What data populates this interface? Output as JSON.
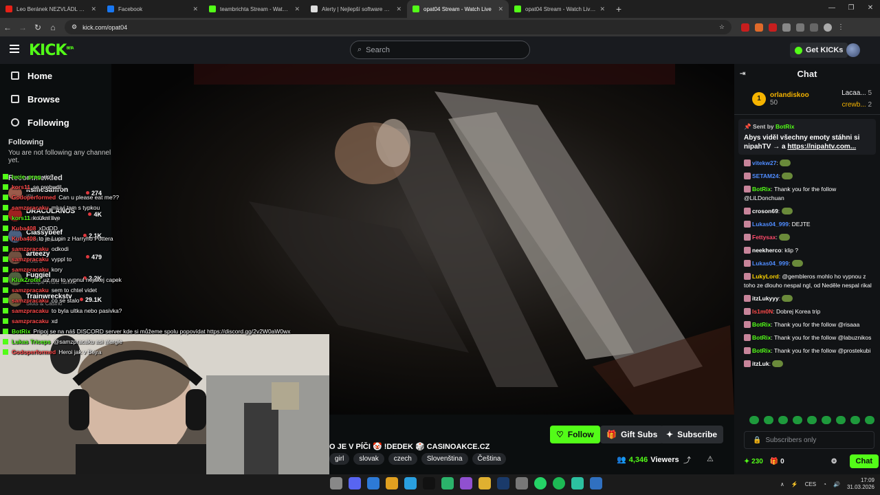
{
  "tabs": [
    {
      "title": "Leo Beránek NEZVLÁDL Svobo",
      "color": "#e62117",
      "active": false
    },
    {
      "title": "Facebook",
      "color": "#1877f2",
      "active": false
    },
    {
      "title": "teambrichta Stream - Watch Liv",
      "color": "#53fc18",
      "active": false
    },
    {
      "title": "Alerty | Nejlepší software pro v",
      "color": "#dddddd",
      "active": false
    },
    {
      "title": "opat04 Stream - Watch Live",
      "color": "#53fc18",
      "active": true
    },
    {
      "title": "opat04 Stream - Watch Live on",
      "color": "#53fc18",
      "active": false
    }
  ],
  "browser": {
    "url": "kick.com/opat04"
  },
  "nav": {
    "logo": "KICK",
    "logo_sup": "BETA",
    "search_placeholder": "Search",
    "get_kicks": "Get KICKs"
  },
  "sidebar": {
    "items": [
      {
        "label": "Home"
      },
      {
        "label": "Browse"
      },
      {
        "label": "Following"
      }
    ],
    "following_title": "Following",
    "following_empty": "You are not following any channel yet.",
    "recommended_title": "Recommended",
    "recommended": [
      {
        "name": "itsmeSaffron",
        "category": "IRL",
        "viewers": "274",
        "color": "#9b5b4b"
      },
      {
        "name": "DRACULANOS",
        "category": "Just Chatting",
        "viewers": "4K",
        "color": "#a02020"
      },
      {
        "name": "Classybeef",
        "category": "Slots & Casino",
        "viewers": "2.1K",
        "color": "#4a6080"
      },
      {
        "name": "arteezy",
        "category": "Dota 2",
        "viewers": "479",
        "color": "#705040"
      },
      {
        "name": "Fuggiel",
        "category": "Escape From Tarkov",
        "viewers": "2.2K",
        "color": "#506040"
      },
      {
        "name": "Trainwreckstv",
        "category": "Slots & Casino",
        "viewers": "29.1K",
        "color": "#6a5a3a"
      }
    ]
  },
  "overlay_chat": [
    {
      "user": "lucie_prag",
      "text": "rip?",
      "color": "#53fc18"
    },
    {
      "user": "kors11",
      "text": "se probudil",
      "color": "#ff4a4a"
    },
    {
      "user": "Godoperformed",
      "text": "Can u please eat me??",
      "color": "#ff4a4a"
    },
    {
      "user": "samzpracaku",
      "text": "mluvi tam s typkou",
      "color": "#ff4a4a"
    },
    {
      "user": "kors11",
      "text": "koukni live",
      "color": "#53fc18"
    },
    {
      "user": "Kuba408",
      "text": "xDdDD",
      "color": "#ff4a4a"
    },
    {
      "user": "Kuba408",
      "text": "to je Lupin z Harryho Pottera",
      "color": "#ff4a4a"
    },
    {
      "user": "samzpracaku",
      "text": "odkodi",
      "color": "#ff4a4a"
    },
    {
      "user": "samzpracaku",
      "text": "vyppl to",
      "color": "#ff4a4a"
    },
    {
      "user": "samzpracaku",
      "text": "kory",
      "color": "#ff4a4a"
    },
    {
      "user": "KlukZrotel",
      "text": "uz mu to vypnul nejakej capek",
      "color": "#53fc18"
    },
    {
      "user": "samzpracaku",
      "text": "sem to chtel videt",
      "color": "#ff4a4a"
    },
    {
      "user": "samzpracaku",
      "text": "co se stalo",
      "color": "#ff4a4a"
    },
    {
      "user": "samzpracaku",
      "text": "to byla ultka nebo pasivka?",
      "color": "#ff4a4a"
    },
    {
      "user": "samzpracaku",
      "text": "xd",
      "color": "#ff4a4a"
    },
    {
      "user": "BotRix",
      "text": "Pripoj se na náš DISCORD server kde si můžeme spolu popovídat https://discord.gg/2v2W0aW0wx",
      "color": "#53fc18"
    },
    {
      "user": "Lukas Triceps",
      "text": "@samzpracaku asi alergie",
      "color": "#53fc18"
    },
    {
      "user": "Godoperformed",
      "text": "Heroi jak v Bejra",
      "color": "#ff4a4a"
    }
  ],
  "stream": {
    "title": "O JE V PÍČI 🤡 !DEDEK 🎲 CASINOAKCE.CZ",
    "tags": [
      "girl",
      "slovak",
      "czech",
      "Slovenština",
      "Čeština"
    ],
    "viewers": "4,346",
    "viewers_label": "Viewers",
    "follow_label": "Follow",
    "gift_label": "Gift Subs",
    "subscribe_label": "Subscribe"
  },
  "chat": {
    "title": "Chat",
    "leader": {
      "name": "orlandiskoo",
      "count": "50",
      "rank": "1",
      "second": {
        "name": "Lacaa...",
        "count": "5"
      },
      "third": {
        "name": "crewb...",
        "count": "2"
      }
    },
    "pinned": {
      "sent_by": "Sent by",
      "bot": "BotRix",
      "text": "Abys viděl všechny emoty stáhni si nipahTV → a ",
      "link": "https://nipahtv.com..."
    },
    "messages": [
      {
        "user": "vitekw27",
        "text": "",
        "color": "#4f8cff"
      },
      {
        "user": "SETAM24",
        "text": "",
        "color": "#4f8cff"
      },
      {
        "user": "BotRix",
        "text": "Thank you for the follow @LiLDonchuan",
        "color": "#53fc18"
      },
      {
        "user": "croson69",
        "text": "",
        "color": "#ffffff"
      },
      {
        "user": "Lukas04_999",
        "text": "DEJTE",
        "color": "#4f8cff"
      },
      {
        "user": "Fettysax",
        "text": "",
        "color": "#ff4a6a"
      },
      {
        "user": "neekherco",
        "text": "klip ?",
        "color": "#ffffff"
      },
      {
        "user": "Lukas04_999",
        "text": "",
        "color": "#4f8cff"
      },
      {
        "user": "LukyLord",
        "text": "@gembleros mohlo ho vypnou z toho ze dlouho nespal ngl, od Neděle nespal rikal",
        "color": "#ffd400"
      },
      {
        "user": "itzLukyyy",
        "text": "",
        "color": "#ffffff"
      },
      {
        "user": "ls1m0N",
        "text": "Dobrej Korea trip",
        "color": "#ff4a4a"
      },
      {
        "user": "BotRix",
        "text": "Thank you for the follow @risaaa",
        "color": "#53fc18"
      },
      {
        "user": "BotRix",
        "text": "Thank you for the follow @labuznikos",
        "color": "#53fc18"
      },
      {
        "user": "BotRix",
        "text": "Thank you for the follow @prostekubi",
        "color": "#53fc18"
      },
      {
        "user": "itzLuk",
        "text": "",
        "color": "#ffffff"
      }
    ],
    "input_placeholder": "Subscribers only",
    "points": "230",
    "gifts": "0",
    "send_label": "Chat"
  },
  "taskbar": {
    "lang": "CES",
    "time": "17:09",
    "date": "31.03.2026"
  }
}
